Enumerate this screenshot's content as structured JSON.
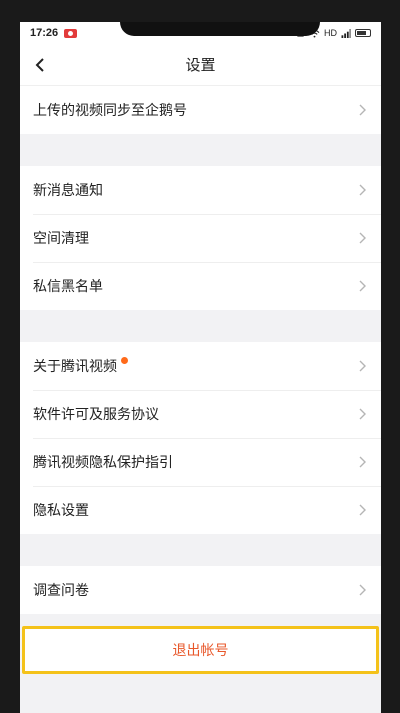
{
  "status_bar": {
    "time": "17:26",
    "right_text": "HD"
  },
  "nav": {
    "title": "设置"
  },
  "groups": [
    {
      "items": [
        {
          "label": "上传的视频同步至企鹅号"
        }
      ]
    },
    {
      "items": [
        {
          "label": "新消息通知"
        },
        {
          "label": "空间清理"
        },
        {
          "label": "私信黑名单"
        }
      ]
    },
    {
      "items": [
        {
          "label": "关于腾讯视频",
          "badge": true
        },
        {
          "label": "软件许可及服务协议"
        },
        {
          "label": "腾讯视频隐私保护指引"
        },
        {
          "label": "隐私设置"
        }
      ]
    },
    {
      "items": [
        {
          "label": "调查问卷"
        }
      ]
    }
  ],
  "logout": {
    "label": "退出帐号"
  },
  "colors": {
    "accent_border": "#f4c21a",
    "logout_text": "#e8572a",
    "badge_dot": "#ff6a1a",
    "background": "#f2f2f4"
  },
  "icons": {
    "back": "chevron-left-icon",
    "row_arrow": "chevron-right-icon",
    "recording": "recording-icon",
    "battery": "battery-icon"
  }
}
